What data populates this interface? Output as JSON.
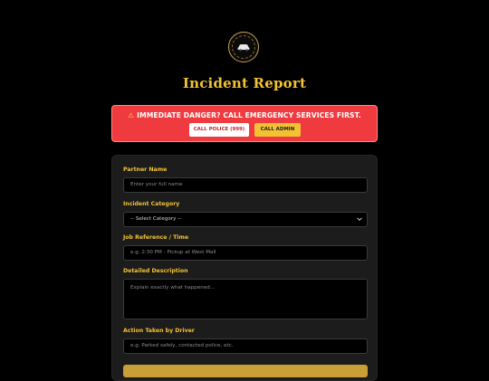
{
  "logo": {
    "name": "logo-badge"
  },
  "page": {
    "title": "Incident Report"
  },
  "alert": {
    "message": "IMMEDIATE DANGER? CALL EMERGENCY SERVICES FIRST.",
    "police_button": "CALL POLICE (999)",
    "admin_button": "CALL ADMIN"
  },
  "form": {
    "partner_name": {
      "label": "Partner Name",
      "placeholder": "Enter your full name"
    },
    "incident_category": {
      "label": "Incident Category",
      "selected": "-- Select Category --"
    },
    "job_reference": {
      "label": "Job Reference / Time",
      "placeholder": "e.g. 2:30 PM - Pickup at West Mall"
    },
    "description": {
      "label": "Detailed Description",
      "placeholder": "Explain exactly what happened..."
    },
    "action_taken": {
      "label": "Action Taken by Driver",
      "placeholder": "e.g. Parked safely, contacted police, etc."
    }
  },
  "colors": {
    "accent": "#f2c233",
    "danger": "#ef3b3f",
    "card": "#1c1c1c",
    "background": "#000000"
  }
}
